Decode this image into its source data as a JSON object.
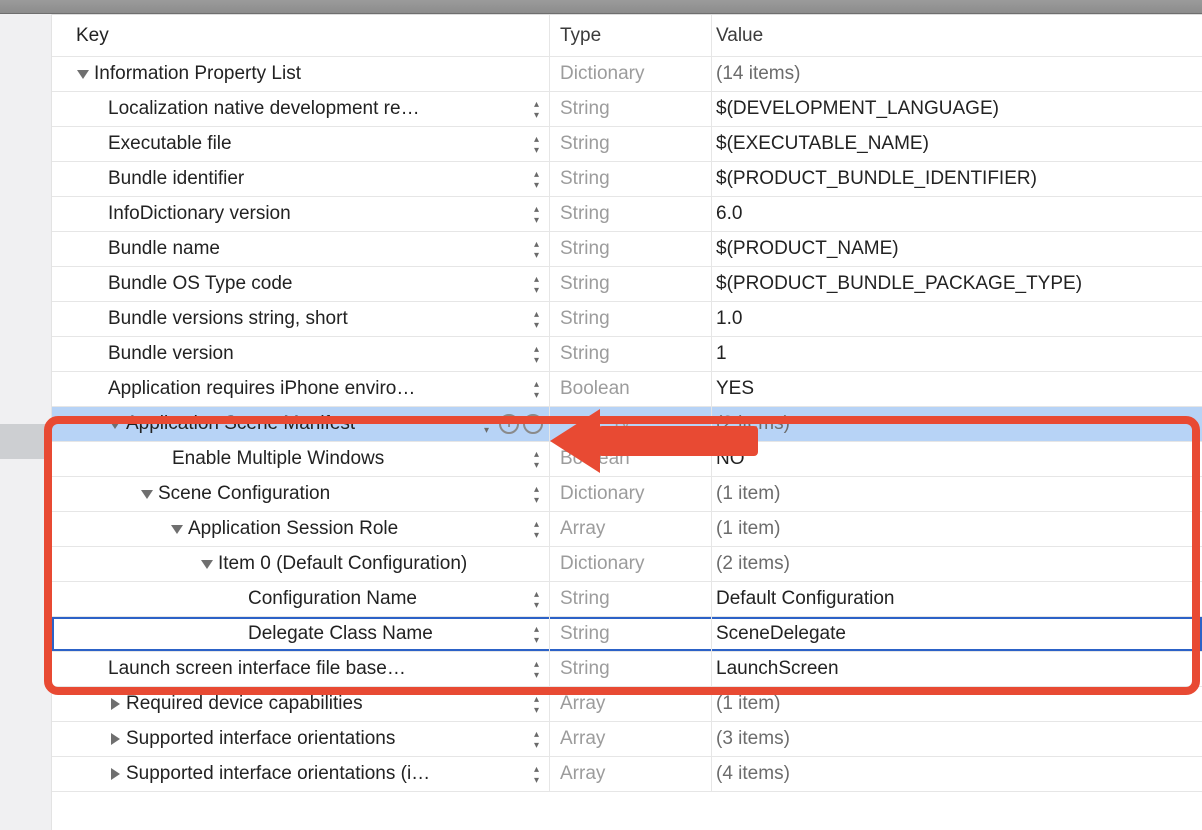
{
  "columns": {
    "key": "Key",
    "type": "Type",
    "value": "Value"
  },
  "root": {
    "label": "Information Property List",
    "type": "Dictionary",
    "value": "(14 items)"
  },
  "rows": [
    {
      "key": "Localization native development re…",
      "type": "String",
      "value": "$(DEVELOPMENT_LANGUAGE)"
    },
    {
      "key": "Executable file",
      "type": "String",
      "value": "$(EXECUTABLE_NAME)"
    },
    {
      "key": "Bundle identifier",
      "type": "String",
      "value": "$(PRODUCT_BUNDLE_IDENTIFIER)"
    },
    {
      "key": "InfoDictionary version",
      "type": "String",
      "value": "6.0"
    },
    {
      "key": "Bundle name",
      "type": "String",
      "value": "$(PRODUCT_NAME)"
    },
    {
      "key": "Bundle OS Type code",
      "type": "String",
      "value": "$(PRODUCT_BUNDLE_PACKAGE_TYPE)"
    },
    {
      "key": "Bundle versions string, short",
      "type": "String",
      "value": "1.0"
    },
    {
      "key": "Bundle version",
      "type": "String",
      "value": "1"
    },
    {
      "key": "Application requires iPhone enviro…",
      "type": "Boolean",
      "value": "YES"
    }
  ],
  "scene": {
    "label": "Application Scene Manifest",
    "type_suffix": "ry",
    "value": "(2 items)",
    "children": {
      "multi": {
        "key": "Enable Multiple Windows",
        "type": "Boolean",
        "value": "NO"
      },
      "config": {
        "key": "Scene Configuration",
        "type": "Dictionary",
        "value": "(1 item)",
        "role": {
          "key": "Application Session Role",
          "type": "Array",
          "value": "(1 item)",
          "item0": {
            "key": "Item 0 (Default Configuration)",
            "type": "Dictionary",
            "value": "(2 items)",
            "cfg_name": {
              "key": "Configuration Name",
              "type": "String",
              "value": "Default Configuration"
            },
            "delegate": {
              "key": "Delegate Class Name",
              "type": "String",
              "value": "SceneDelegate"
            }
          }
        }
      }
    }
  },
  "tail": [
    {
      "key": "Launch screen interface file base…",
      "type": "String",
      "value": "LaunchScreen",
      "disclosure": "none"
    },
    {
      "key": "Required device capabilities",
      "type": "Array",
      "value": "(1 item)",
      "disclosure": "right"
    },
    {
      "key": "Supported interface orientations",
      "type": "Array",
      "value": "(3 items)",
      "disclosure": "right"
    },
    {
      "key": "Supported interface orientations (i…",
      "type": "Array",
      "value": "(4 items)",
      "disclosure": "right"
    }
  ]
}
